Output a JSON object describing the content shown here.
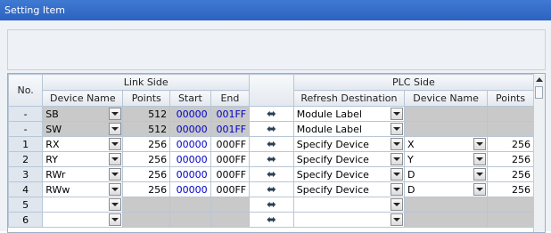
{
  "window": {
    "title": "Setting Item"
  },
  "table": {
    "group_headers": {
      "no": "No.",
      "link_side": "Link Side",
      "plc_side": "PLC Side"
    },
    "column_headers": {
      "device_name": "Device Name",
      "points": "Points",
      "start": "Start",
      "end": "End",
      "refresh_destination": "Refresh Destination",
      "plc_device_name": "Device Name",
      "plc_points": "Points"
    },
    "arrow_icon": "double-arrow-icon",
    "rows": [
      {
        "no": "-",
        "device": "SB",
        "points": "512",
        "start": "00000",
        "end": "001FF",
        "refresh": "Module Label",
        "plc_device": "",
        "plc_points": ""
      },
      {
        "no": "-",
        "device": "SW",
        "points": "512",
        "start": "00000",
        "end": "001FF",
        "refresh": "Module Label",
        "plc_device": "",
        "plc_points": ""
      },
      {
        "no": "1",
        "device": "RX",
        "points": "256",
        "start": "00000",
        "end": "000FF",
        "refresh": "Specify Device",
        "plc_device": "X",
        "plc_points": "256"
      },
      {
        "no": "2",
        "device": "RY",
        "points": "256",
        "start": "00000",
        "end": "000FF",
        "refresh": "Specify Device",
        "plc_device": "Y",
        "plc_points": "256"
      },
      {
        "no": "3",
        "device": "RWr",
        "points": "256",
        "start": "00000",
        "end": "000FF",
        "refresh": "Specify Device",
        "plc_device": "D",
        "plc_points": "256"
      },
      {
        "no": "4",
        "device": "RWw",
        "points": "256",
        "start": "00000",
        "end": "000FF",
        "refresh": "Specify Device",
        "plc_device": "D",
        "plc_points": "256"
      },
      {
        "no": "5",
        "device": "",
        "points": "",
        "start": "",
        "end": "",
        "refresh": "",
        "plc_device": "",
        "plc_points": ""
      },
      {
        "no": "6",
        "device": "",
        "points": "",
        "start": "",
        "end": "",
        "refresh": "",
        "plc_device": "",
        "plc_points": ""
      }
    ]
  },
  "colors": {
    "title_bar": "#2c63c0",
    "panel": "#eef2f6",
    "disabled_cell": "#c9c9c9",
    "address_text": "#0000c8"
  }
}
